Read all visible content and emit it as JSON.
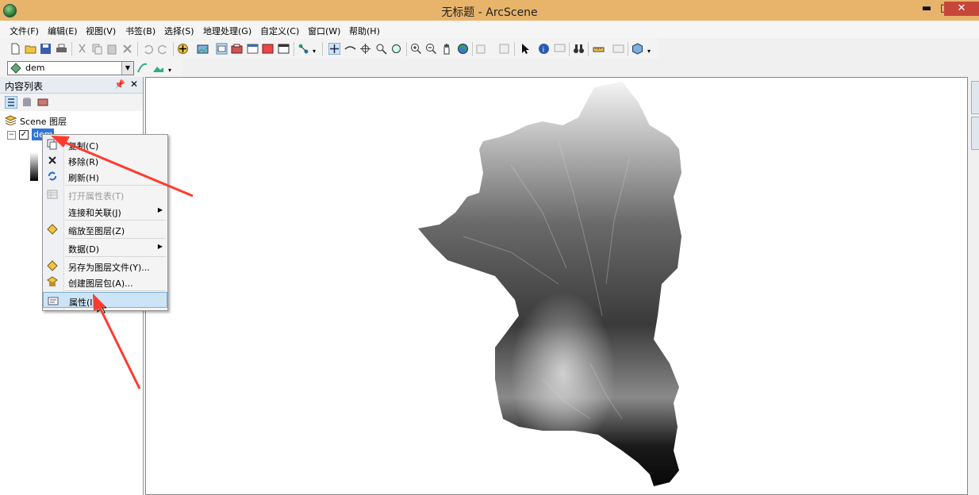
{
  "window": {
    "title": "无标题 - ArcScene",
    "minimize": "▬",
    "maximize": "□",
    "close": "✕"
  },
  "menu": [
    "文件(F)",
    "编辑(E)",
    "视图(V)",
    "书签(B)",
    "选择(S)",
    "地理处理(G)",
    "自定义(C)",
    "窗口(W)",
    "帮助(H)"
  ],
  "layer_toolbar": {
    "selected_layer": "dem"
  },
  "toc": {
    "title": "内容列表",
    "pin": "ᵖ",
    "close": "✕",
    "scene_layers": "Scene 图层",
    "layer_name": "dem"
  },
  "context_menu": {
    "items": [
      {
        "label": "复制(C)",
        "icon": "copy-icon",
        "enabled": true
      },
      {
        "label": "移除(R)",
        "icon": "remove-x-icon",
        "enabled": true
      },
      {
        "label": "刷新(H)",
        "icon": "refresh-icon",
        "enabled": true
      },
      {
        "label": "打开属性表(T)",
        "icon": "table-icon",
        "enabled": false
      },
      {
        "label": "连接和关联(J)",
        "icon": "",
        "enabled": true,
        "submenu": true
      },
      {
        "label": "缩放至图层(Z)",
        "icon": "zoom-layer-icon",
        "enabled": true
      },
      {
        "label": "数据(D)",
        "icon": "",
        "enabled": true,
        "submenu": true
      },
      {
        "label": "另存为图层文件(Y)...",
        "icon": "layer-file-icon",
        "enabled": true
      },
      {
        "label": "创建图层包(A)...",
        "icon": "layer-package-icon",
        "enabled": true
      },
      {
        "label": "属性(I)",
        "icon": "properties-icon",
        "enabled": true,
        "highlighted": true
      }
    ]
  },
  "colors": {
    "titlebar": "#e8b46b",
    "highlight": "#cde4f7",
    "annotation_arrow": "#ff3b30"
  }
}
